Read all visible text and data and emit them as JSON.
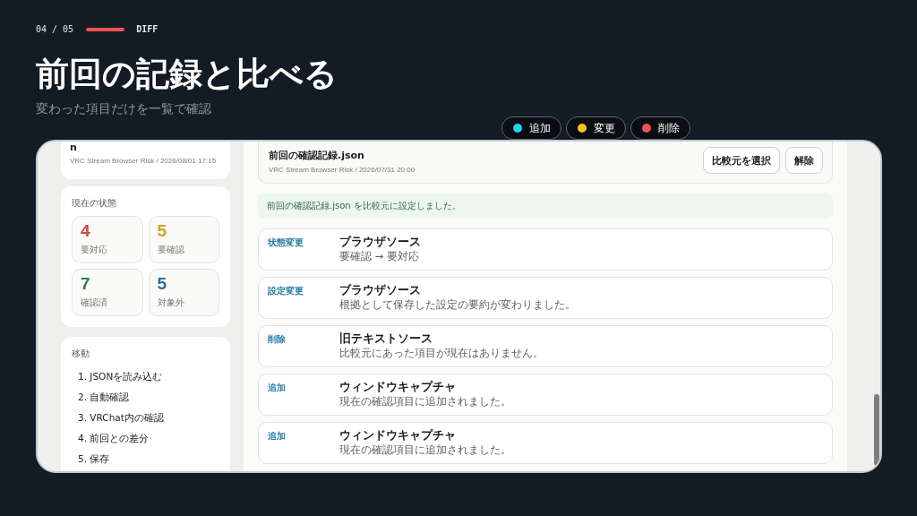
{
  "slide": {
    "counter": "04 / 05",
    "section": "DIFF",
    "title": "前回の記録と比べる",
    "subtitle": "変わった項目だけを一覧で確認"
  },
  "legend": [
    {
      "label": "追加",
      "color": "#22d3ee"
    },
    {
      "label": "変更",
      "color": "#fbbf24"
    },
    {
      "label": "削除",
      "color": "#f05252"
    }
  ],
  "sidebar": {
    "record": {
      "name": "n",
      "meta": "VRC Stream Browser Risk / 2026/08/01 17:15"
    },
    "status": {
      "title": "現在の状態",
      "counts": [
        {
          "value": "4",
          "label": "要対応",
          "color": "#d64545"
        },
        {
          "value": "5",
          "label": "要確認",
          "color": "#d4a21a"
        },
        {
          "value": "7",
          "label": "確認済",
          "color": "#2e7d57"
        },
        {
          "value": "5",
          "label": "対象外",
          "color": "#2a6f97"
        }
      ]
    },
    "navigation": {
      "title": "移動",
      "items": [
        {
          "label": "1. JSONを読み込む"
        },
        {
          "label": "2. 自動確認"
        },
        {
          "label": "3. VRChat内の確認"
        },
        {
          "label": "4. 前回との差分"
        },
        {
          "label": "5. 保存"
        }
      ]
    }
  },
  "comparison": {
    "file": {
      "name": "前回の確認記録.json",
      "meta": "VRC Stream Browser Risk / 2026/07/31 20:00"
    },
    "buttons": [
      "比較元を選択",
      "解除"
    ],
    "notice": "前回の確認記録.json を比較元に設定しました。",
    "changes": [
      {
        "label": "状態変更",
        "title": "ブラウザソース",
        "detail": "要確認 → 要対応"
      },
      {
        "label": "設定変更",
        "title": "ブラウザソース",
        "detail": "根拠として保存した設定の要約が変わりました。"
      },
      {
        "label": "削除",
        "title": "旧テキストソース",
        "detail": "比較元にあった項目が現在はありません。"
      },
      {
        "label": "追加",
        "title": "ウィンドウキャプチャ",
        "detail": "現在の確認項目に追加されました。"
      },
      {
        "label": "追加",
        "title": "ウィンドウキャプチャ",
        "detail": "現在の確認項目に追加されました。"
      }
    ]
  }
}
